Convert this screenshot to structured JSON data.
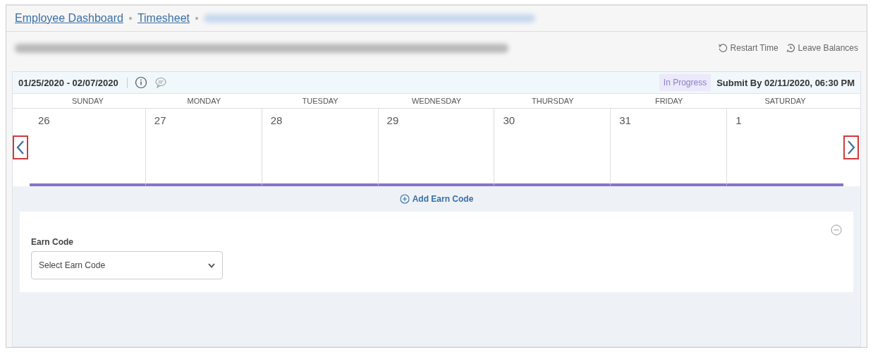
{
  "breadcrumb": [
    {
      "label": "Employee Dashboard"
    },
    {
      "label": "Timesheet"
    }
  ],
  "header": {
    "actions": [
      {
        "label": "Restart Time"
      },
      {
        "label": "Leave Balances"
      }
    ]
  },
  "period": {
    "range": "01/25/2020 - 02/07/2020",
    "status": "In Progress",
    "submit_by": "Submit By 02/11/2020, 06:30 PM"
  },
  "days": [
    {
      "name": "SUNDAY",
      "date": "26"
    },
    {
      "name": "MONDAY",
      "date": "27"
    },
    {
      "name": "TUESDAY",
      "date": "28"
    },
    {
      "name": "WEDNESDAY",
      "date": "29"
    },
    {
      "name": "THURSDAY",
      "date": "30"
    },
    {
      "name": "FRIDAY",
      "date": "31"
    },
    {
      "name": "SATURDAY",
      "date": "1"
    }
  ],
  "add_button": "Add Earn Code",
  "earn_code": {
    "label": "Earn Code",
    "placeholder": "Select Earn Code"
  }
}
